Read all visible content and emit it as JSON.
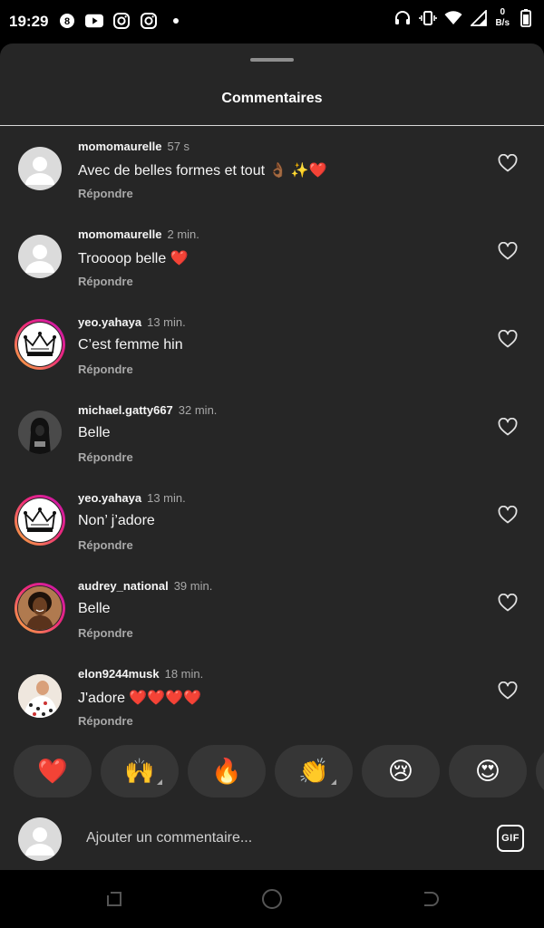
{
  "status_bar": {
    "time": "19:29",
    "app_icons": [
      "8-notification-icon",
      "youtube-icon",
      "instagram-icon",
      "instagram-icon"
    ],
    "net_speed_value": "0",
    "net_speed_unit": "B/s"
  },
  "sheet": {
    "title": "Commentaires"
  },
  "comments": [
    {
      "username": "momomaurelle",
      "time": "57 s",
      "text": "Avec de belles formes et tout 👌🏾 ✨❤️",
      "reply_label": "Répondre",
      "avatar": "default",
      "story_ring": false
    },
    {
      "username": "momomaurelle",
      "time": "2 min.",
      "text": "Troooop belle ❤️",
      "reply_label": "Répondre",
      "avatar": "default",
      "story_ring": false
    },
    {
      "username": "yeo.yahaya",
      "time": "13 min.",
      "text": "C’est femme hin",
      "reply_label": "Répondre",
      "avatar": "crown",
      "story_ring": true
    },
    {
      "username": "michael.gatty667",
      "time": "32 min.",
      "text": "Belle",
      "reply_label": "Répondre",
      "avatar": "hooded-figure",
      "story_ring": false
    },
    {
      "username": "yeo.yahaya",
      "time": "13 min.",
      "text": "Non’ j’adore",
      "reply_label": "Répondre",
      "avatar": "crown",
      "story_ring": true
    },
    {
      "username": "audrey_national",
      "time": "39 min.",
      "text": "Belle",
      "reply_label": "Répondre",
      "avatar": "portrait",
      "story_ring": true
    },
    {
      "username": "elon9244musk",
      "time": "18 min.",
      "text": "J'adore ❤️❤️❤️❤️",
      "reply_label": "Répondre",
      "avatar": "pattern",
      "story_ring": false
    }
  ],
  "reactions": [
    {
      "emoji": "❤️",
      "name": "red-heart-reaction",
      "has_variants": false
    },
    {
      "emoji": "🙌",
      "name": "raising-hands-reaction",
      "has_variants": true
    },
    {
      "emoji": "🔥",
      "name": "fire-reaction",
      "has_variants": false
    },
    {
      "emoji": "👏",
      "name": "clapping-hands-reaction",
      "has_variants": true
    },
    {
      "emoji": "😢",
      "name": "crying-face-reaction",
      "has_variants": false
    },
    {
      "emoji": "😍",
      "name": "heart-eyes-reaction",
      "has_variants": false
    }
  ],
  "composer": {
    "placeholder": "Ajouter un commentaire...",
    "gif_label": "GIF"
  },
  "colors": {
    "sheet_background": "#262626",
    "story_ring_gradient": [
      "#f9b33a",
      "#ee2a7b",
      "#c413b1"
    ],
    "secondary_text": "#a8a8a8"
  }
}
